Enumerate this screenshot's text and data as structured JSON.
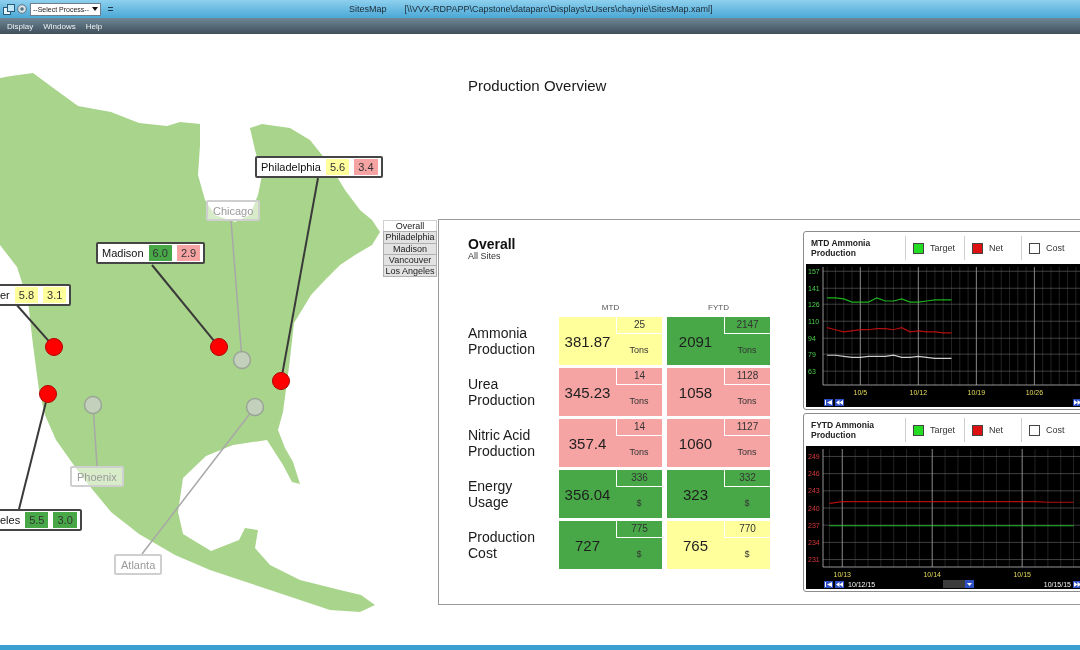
{
  "window": {
    "title": "SitesMap",
    "path": "[\\\\VVX-RDPAPP\\Capstone\\dataparc\\Displays\\zUsers\\chaynie\\SitesMap.xaml]",
    "process_select": {
      "value": "--Select Process--"
    }
  },
  "menu": [
    "Display",
    "Windows",
    "Help"
  ],
  "heading": "Production Overview",
  "map": {
    "sites": [
      {
        "name": "Philadelphia",
        "active": true,
        "values": [
          {
            "text": "5.6",
            "color": "#ffff9c"
          },
          {
            "text": "3.4",
            "color": "#f5a3a3"
          }
        ]
      },
      {
        "name": "Chicago",
        "active": false
      },
      {
        "name": "Madison",
        "active": true,
        "values": [
          {
            "text": "6.0",
            "color": "#48a848"
          },
          {
            "text": "2.9",
            "color": "#f5a3a3"
          }
        ]
      },
      {
        "name": "er",
        "active": true,
        "values": [
          {
            "text": "5.8",
            "color": "#ffff9c"
          },
          {
            "text": "3.1",
            "color": "#ffff9c"
          }
        ]
      },
      {
        "name": "Phoenix",
        "active": false
      },
      {
        "name": "eles",
        "active": true,
        "values": [
          {
            "text": "5.5",
            "color": "#48a848"
          },
          {
            "text": "3.0",
            "color": "#48a848"
          }
        ]
      },
      {
        "name": "Atlanta",
        "active": false
      }
    ]
  },
  "site_tabs": [
    {
      "label": "Overall",
      "selected": true
    },
    {
      "label": "Philadelphia",
      "selected": false
    },
    {
      "label": "Madison",
      "selected": false
    },
    {
      "label": "Vancouver",
      "selected": false
    },
    {
      "label": "Los Angeles",
      "selected": false
    }
  ],
  "overview": {
    "title": "Overall",
    "subtitle": "All Sites",
    "columns": [
      "MTD",
      "FYTD"
    ],
    "rows": [
      {
        "label": "Ammonia Production",
        "cells": [
          {
            "value": "381.87",
            "target": "25",
            "unit": "Tons",
            "color": "#ffff9c"
          },
          {
            "value": "2091",
            "target": "2147",
            "unit": "Tons",
            "color": "#48a848"
          }
        ]
      },
      {
        "label": "Urea Production",
        "cells": [
          {
            "value": "345.23",
            "target": "14",
            "unit": "Tons",
            "color": "#f5a3a3"
          },
          {
            "value": "1058",
            "target": "1128",
            "unit": "Tons",
            "color": "#f5a3a3"
          }
        ]
      },
      {
        "label": "Nitric Acid Production",
        "cells": [
          {
            "value": "357.4",
            "target": "14",
            "unit": "Tons",
            "color": "#f5a3a3"
          },
          {
            "value": "1060",
            "target": "1127",
            "unit": "Tons",
            "color": "#f5a3a3"
          }
        ]
      },
      {
        "label": "Energy Usage",
        "cells": [
          {
            "value": "356.04",
            "target": "336",
            "unit": "$",
            "color": "#48a848"
          },
          {
            "value": "323",
            "target": "332",
            "unit": "$",
            "color": "#48a848"
          }
        ]
      },
      {
        "label": "Production Cost",
        "cells": [
          {
            "value": "727",
            "target": "775",
            "unit": "$",
            "color": "#48a848"
          },
          {
            "value": "765",
            "target": "770",
            "unit": "$",
            "color": "#ffff9c"
          }
        ]
      }
    ]
  },
  "charts": [
    {
      "chart_data": {
        "type": "line",
        "title": "MTD Ammonia Production",
        "categories": [
          null,
          null,
          null,
          null,
          "10/5",
          null,
          null,
          null,
          null,
          null,
          null,
          "10/12",
          null,
          null,
          null,
          null,
          null,
          null,
          "10/19",
          null,
          null,
          null,
          null,
          null,
          null,
          "10/26",
          null,
          null,
          null,
          null,
          null
        ],
        "ylim": [
          50,
          161
        ],
        "yticks": [
          63,
          79,
          94,
          110,
          126,
          141,
          157
        ],
        "grid": true,
        "series": [
          {
            "name": "Target",
            "color": "#22dd22",
            "values": [
              132,
              132,
              131,
              128,
              128,
              128,
              132,
              129,
              129,
              131,
              128,
              128,
              129,
              130,
              130,
              130,
              null,
              null,
              null,
              null,
              null,
              null,
              null,
              null,
              null,
              null,
              null,
              null,
              null,
              null,
              null
            ]
          },
          {
            "name": "Net",
            "color": "#dd1111",
            "values": [
              104,
              102,
              100,
              101,
              102,
              102,
              103,
              103,
              102,
              104,
              100,
              101,
              100,
              100,
              99,
              99,
              null,
              null,
              null,
              null,
              null,
              null,
              null,
              null,
              null,
              null,
              null,
              null,
              null,
              null,
              null
            ]
          },
          {
            "name": "Cost",
            "color": "#ffffff",
            "values": [
              78,
              78,
              77,
              76,
              76,
              77,
              77,
              77,
              78,
              76,
              76,
              77,
              76,
              75,
              75,
              75,
              null,
              null,
              null,
              null,
              null,
              null,
              null,
              null,
              null,
              null,
              null,
              null,
              null,
              null,
              null
            ]
          }
        ]
      }
    },
    {
      "chart_data": {
        "type": "line",
        "title": "FYTD Ammonia Production",
        "categories": [
          null,
          "10/13",
          null,
          null,
          null,
          null,
          null,
          null,
          "10/14",
          null,
          null,
          null,
          null,
          null,
          null,
          "10/15",
          null,
          null,
          null,
          null
        ],
        "ylim": [
          229.7,
          250.3
        ],
        "yticks": [
          231,
          234,
          237,
          240,
          243,
          246,
          249
        ],
        "grid": true,
        "series": [
          {
            "name": "Target",
            "color": "#22dd22",
            "values": [
              236.9,
              236.9,
              236.9,
              236.9,
              236.9,
              236.9,
              236.9,
              236.9,
              236.9,
              236.9,
              236.9,
              236.9,
              236.9,
              236.9,
              236.9,
              236.9,
              236.9,
              236.9,
              236.9,
              236.9
            ]
          },
          {
            "name": "Net",
            "color": "#dd1111",
            "values": [
              240.8,
              241.1,
              241.1,
              241.1,
              241.1,
              241.1,
              241.1,
              241.1,
              241.1,
              241.1,
              241.1,
              241.1,
              241.1,
              241.1,
              241.1,
              241.1,
              241.1,
              241.0,
              241.0,
              241.0
            ]
          },
          {
            "name": "Cost",
            "color": "#ffffff",
            "values": [
              null,
              null,
              null,
              null,
              null,
              null,
              null,
              null,
              null,
              null,
              null,
              null,
              null,
              null,
              null,
              null,
              null,
              null,
              null,
              null
            ]
          }
        ]
      },
      "range_start": "10/12/15",
      "range_end": "10/15/15"
    }
  ]
}
